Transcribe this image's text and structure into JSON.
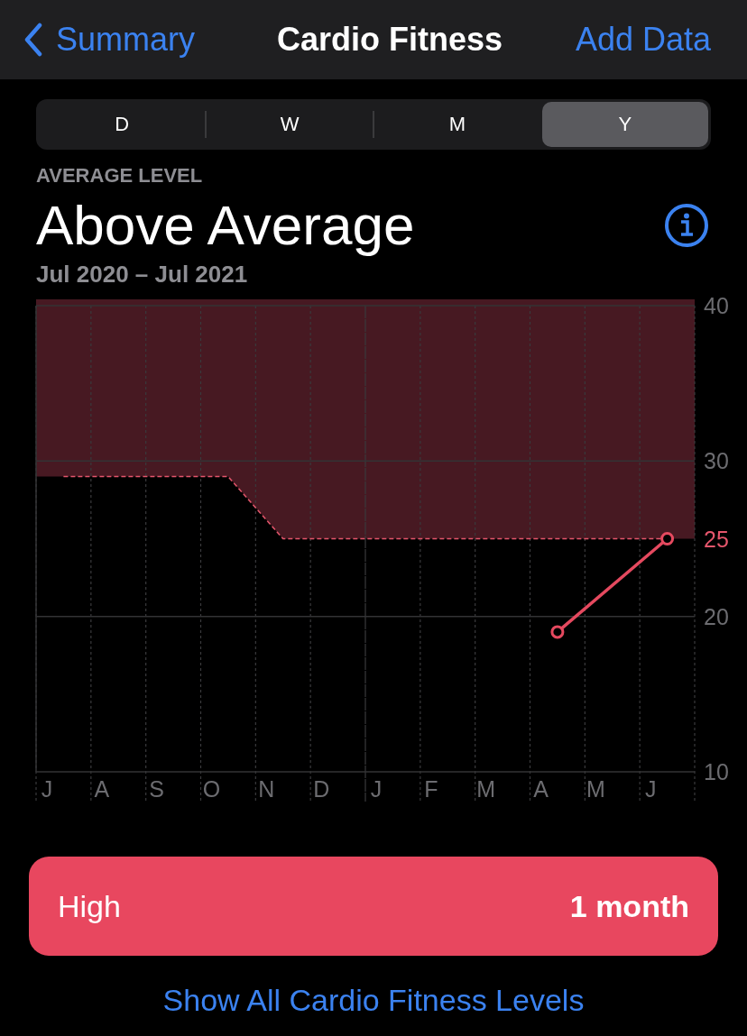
{
  "nav": {
    "back": "Summary",
    "title": "Cardio Fitness",
    "action": "Add Data"
  },
  "segments": [
    {
      "label": "D",
      "selected": false
    },
    {
      "label": "W",
      "selected": false
    },
    {
      "label": "M",
      "selected": false
    },
    {
      "label": "Y",
      "selected": true
    }
  ],
  "summary": {
    "caption": "AVERAGE LEVEL",
    "level": "Above Average",
    "range": "Jul 2020 – Jul 2021"
  },
  "chart": {
    "chart_data": {
      "type": "line",
      "categories": [
        "J",
        "A",
        "S",
        "O",
        "N",
        "D",
        "J",
        "F",
        "M",
        "A",
        "M",
        "J"
      ],
      "series": [
        {
          "color": "#e5566c",
          "line_style": "dashed",
          "values": [
            29,
            29,
            29,
            29,
            25,
            25,
            25,
            25,
            25,
            25,
            25,
            25
          ]
        },
        {
          "color": "#e5495f",
          "marker": "circle",
          "values": [
            null,
            null,
            null,
            null,
            null,
            null,
            null,
            null,
            null,
            19,
            null,
            25
          ]
        }
      ],
      "ylim": [
        10,
        40
      ],
      "yticks": [
        10,
        20,
        25,
        30,
        40
      ]
    }
  },
  "level_card": {
    "label": "High",
    "duration": "1 month"
  },
  "link": "Show All Cardio Fitness Levels"
}
